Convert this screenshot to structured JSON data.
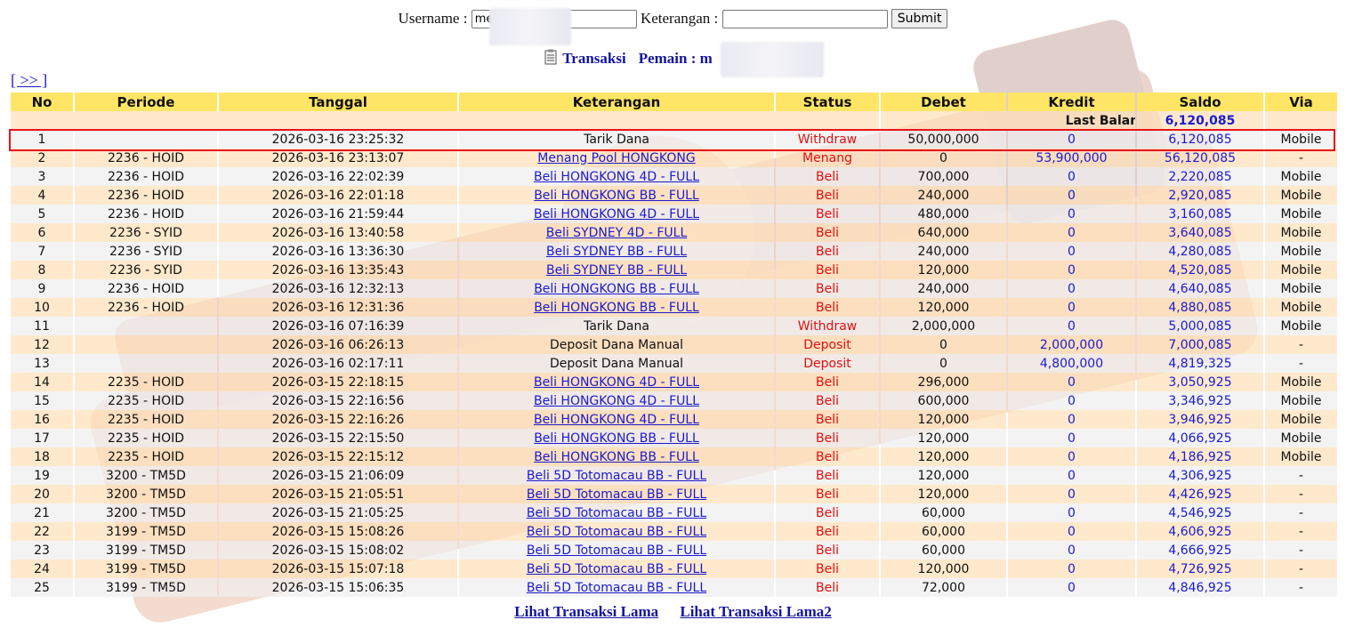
{
  "form": {
    "username_label": "Username :",
    "username_value": "me",
    "keterangan_label": "Keterangan :",
    "keterangan_value": "",
    "submit_label": "Submit"
  },
  "title": {
    "transaksi_label": "Transaksi",
    "pemain_label": "Pemain : m",
    "icon": "document-list-icon"
  },
  "nav": {
    "next_label": "[ >> ]"
  },
  "table": {
    "headers": [
      "No",
      "Periode",
      "Tanggal",
      "Keterangan",
      "Status",
      "Debet",
      "Kredit",
      "Saldo",
      "Via"
    ],
    "last_balance_label": "Last Balance",
    "last_balance_value": "6,120,085",
    "rows": [
      {
        "no": "1",
        "periode": "",
        "tanggal": "2026-03-16 23:25:32",
        "keterangan": "Tarik Dana",
        "link": false,
        "status": "Withdraw",
        "debet": "50,000,000",
        "kredit": "0",
        "saldo": "6,120,085",
        "via": "Mobile"
      },
      {
        "no": "2",
        "periode": "2236 - HOID",
        "tanggal": "2026-03-16 23:13:07",
        "keterangan": "Menang Pool HONGKONG",
        "link": true,
        "status": "Menang",
        "debet": "0",
        "kredit": "53,900,000",
        "saldo": "56,120,085",
        "via": "-"
      },
      {
        "no": "3",
        "periode": "2236 - HOID",
        "tanggal": "2026-03-16 22:02:39",
        "keterangan": "Beli HONGKONG 4D - FULL",
        "link": true,
        "status": "Beli",
        "debet": "700,000",
        "kredit": "0",
        "saldo": "2,220,085",
        "via": "Mobile"
      },
      {
        "no": "4",
        "periode": "2236 - HOID",
        "tanggal": "2026-03-16 22:01:18",
        "keterangan": "Beli HONGKONG BB - FULL",
        "link": true,
        "status": "Beli",
        "debet": "240,000",
        "kredit": "0",
        "saldo": "2,920,085",
        "via": "Mobile"
      },
      {
        "no": "5",
        "periode": "2236 - HOID",
        "tanggal": "2026-03-16 21:59:44",
        "keterangan": "Beli HONGKONG 4D - FULL",
        "link": true,
        "status": "Beli",
        "debet": "480,000",
        "kredit": "0",
        "saldo": "3,160,085",
        "via": "Mobile"
      },
      {
        "no": "6",
        "periode": "2236 - SYID",
        "tanggal": "2026-03-16 13:40:58",
        "keterangan": "Beli SYDNEY 4D - FULL",
        "link": true,
        "status": "Beli",
        "debet": "640,000",
        "kredit": "0",
        "saldo": "3,640,085",
        "via": "Mobile"
      },
      {
        "no": "7",
        "periode": "2236 - SYID",
        "tanggal": "2026-03-16 13:36:30",
        "keterangan": "Beli SYDNEY BB - FULL",
        "link": true,
        "status": "Beli",
        "debet": "240,000",
        "kredit": "0",
        "saldo": "4,280,085",
        "via": "Mobile"
      },
      {
        "no": "8",
        "periode": "2236 - SYID",
        "tanggal": "2026-03-16 13:35:43",
        "keterangan": "Beli SYDNEY BB - FULL",
        "link": true,
        "status": "Beli",
        "debet": "120,000",
        "kredit": "0",
        "saldo": "4,520,085",
        "via": "Mobile"
      },
      {
        "no": "9",
        "periode": "2236 - HOID",
        "tanggal": "2026-03-16 12:32:13",
        "keterangan": "Beli HONGKONG BB - FULL",
        "link": true,
        "status": "Beli",
        "debet": "240,000",
        "kredit": "0",
        "saldo": "4,640,085",
        "via": "Mobile"
      },
      {
        "no": "10",
        "periode": "2236 - HOID",
        "tanggal": "2026-03-16 12:31:36",
        "keterangan": "Beli HONGKONG BB - FULL",
        "link": true,
        "status": "Beli",
        "debet": "120,000",
        "kredit": "0",
        "saldo": "4,880,085",
        "via": "Mobile"
      },
      {
        "no": "11",
        "periode": "",
        "tanggal": "2026-03-16 07:16:39",
        "keterangan": "Tarik Dana",
        "link": false,
        "status": "Withdraw",
        "debet": "2,000,000",
        "kredit": "0",
        "saldo": "5,000,085",
        "via": "Mobile"
      },
      {
        "no": "12",
        "periode": "",
        "tanggal": "2026-03-16 06:26:13",
        "keterangan": "Deposit Dana Manual",
        "link": false,
        "status": "Deposit",
        "debet": "0",
        "kredit": "2,000,000",
        "saldo": "7,000,085",
        "via": "-"
      },
      {
        "no": "13",
        "periode": "",
        "tanggal": "2026-03-16 02:17:11",
        "keterangan": "Deposit Dana Manual",
        "link": false,
        "status": "Deposit",
        "debet": "0",
        "kredit": "4,800,000",
        "saldo": "4,819,325",
        "via": "-"
      },
      {
        "no": "14",
        "periode": "2235 - HOID",
        "tanggal": "2026-03-15 22:18:15",
        "keterangan": "Beli HONGKONG 4D - FULL",
        "link": true,
        "status": "Beli",
        "debet": "296,000",
        "kredit": "0",
        "saldo": "3,050,925",
        "via": "Mobile"
      },
      {
        "no": "15",
        "periode": "2235 - HOID",
        "tanggal": "2026-03-15 22:16:56",
        "keterangan": "Beli HONGKONG 4D - FULL",
        "link": true,
        "status": "Beli",
        "debet": "600,000",
        "kredit": "0",
        "saldo": "3,346,925",
        "via": "Mobile"
      },
      {
        "no": "16",
        "periode": "2235 - HOID",
        "tanggal": "2026-03-15 22:16:26",
        "keterangan": "Beli HONGKONG 4D - FULL",
        "link": true,
        "status": "Beli",
        "debet": "120,000",
        "kredit": "0",
        "saldo": "3,946,925",
        "via": "Mobile"
      },
      {
        "no": "17",
        "periode": "2235 - HOID",
        "tanggal": "2026-03-15 22:15:50",
        "keterangan": "Beli HONGKONG BB - FULL",
        "link": true,
        "status": "Beli",
        "debet": "120,000",
        "kredit": "0",
        "saldo": "4,066,925",
        "via": "Mobile"
      },
      {
        "no": "18",
        "periode": "2235 - HOID",
        "tanggal": "2026-03-15 22:15:12",
        "keterangan": "Beli HONGKONG BB - FULL",
        "link": true,
        "status": "Beli",
        "debet": "120,000",
        "kredit": "0",
        "saldo": "4,186,925",
        "via": "Mobile"
      },
      {
        "no": "19",
        "periode": "3200 - TM5D",
        "tanggal": "2026-03-15 21:06:09",
        "keterangan": "Beli 5D Totomacau BB - FULL",
        "link": true,
        "status": "Beli",
        "debet": "120,000",
        "kredit": "0",
        "saldo": "4,306,925",
        "via": "-"
      },
      {
        "no": "20",
        "periode": "3200 - TM5D",
        "tanggal": "2026-03-15 21:05:51",
        "keterangan": "Beli 5D Totomacau BB - FULL",
        "link": true,
        "status": "Beli",
        "debet": "120,000",
        "kredit": "0",
        "saldo": "4,426,925",
        "via": "-"
      },
      {
        "no": "21",
        "periode": "3200 - TM5D",
        "tanggal": "2026-03-15 21:05:25",
        "keterangan": "Beli 5D Totomacau BB - FULL",
        "link": true,
        "status": "Beli",
        "debet": "60,000",
        "kredit": "0",
        "saldo": "4,546,925",
        "via": "-"
      },
      {
        "no": "22",
        "periode": "3199 - TM5D",
        "tanggal": "2026-03-15 15:08:26",
        "keterangan": "Beli 5D Totomacau BB - FULL",
        "link": true,
        "status": "Beli",
        "debet": "60,000",
        "kredit": "0",
        "saldo": "4,606,925",
        "via": "-"
      },
      {
        "no": "23",
        "periode": "3199 - TM5D",
        "tanggal": "2026-03-15 15:08:02",
        "keterangan": "Beli 5D Totomacau BB - FULL",
        "link": true,
        "status": "Beli",
        "debet": "60,000",
        "kredit": "0",
        "saldo": "4,666,925",
        "via": "-"
      },
      {
        "no": "24",
        "periode": "3199 - TM5D",
        "tanggal": "2026-03-15 15:07:18",
        "keterangan": "Beli 5D Totomacau BB - FULL",
        "link": true,
        "status": "Beli",
        "debet": "120,000",
        "kredit": "0",
        "saldo": "4,726,925",
        "via": "-"
      },
      {
        "no": "25",
        "periode": "3199 - TM5D",
        "tanggal": "2026-03-15 15:06:35",
        "keterangan": "Beli 5D Totomacau BB - FULL",
        "link": true,
        "status": "Beli",
        "debet": "72,000",
        "kredit": "0",
        "saldo": "4,846,925",
        "via": "-"
      }
    ]
  },
  "footer": {
    "link1_label": "Lihat Transaksi Lama",
    "link2_label": "Lihat Transaksi Lama2"
  },
  "colors": {
    "header_bg": "#ffe566",
    "row_odd": "#ffe1b9",
    "row_even": "#eeeeee",
    "link_blue": "#1a1ad0",
    "status_red": "#e01010",
    "highlight_border": "#e8141a"
  }
}
